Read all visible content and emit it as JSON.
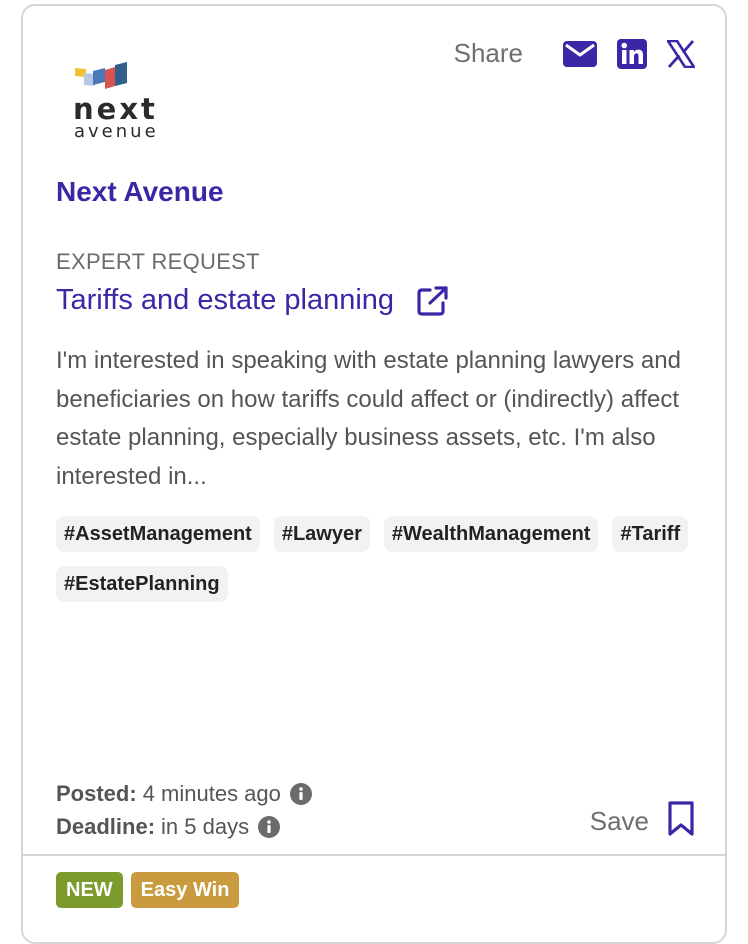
{
  "share": {
    "label": "Share"
  },
  "icons": {
    "email": "envelope-icon",
    "linkedin": "linkedin-icon",
    "x": "x-logo-icon",
    "external": "external-link-icon",
    "info": "info-icon",
    "bookmark": "bookmark-icon"
  },
  "logo": {
    "line1": "next",
    "line2": "avenue"
  },
  "org": {
    "name": "Next Avenue"
  },
  "request": {
    "type": "EXPERT REQUEST",
    "title": "Tariffs and estate planning",
    "description": "I'm interested in speaking with estate planning lawyers and beneficiaries on how tariffs could affect or (indirectly) affect estate planning, especially business assets, etc. I'm also interested in..."
  },
  "tags": [
    "#AssetManagement",
    "#Lawyer",
    "#WealthManagement",
    "#Tariff",
    "#EstatePlanning"
  ],
  "meta": {
    "posted_label": "Posted:",
    "posted_value": "4 minutes ago",
    "deadline_label": "Deadline:",
    "deadline_value": "in 5 days"
  },
  "save": {
    "label": "Save"
  },
  "badges": {
    "new": "NEW",
    "easy": "Easy Win"
  },
  "colors": {
    "accent": "#3a27a6",
    "new_badge": "#7d9a2c",
    "easy_badge": "#c99b3e"
  }
}
